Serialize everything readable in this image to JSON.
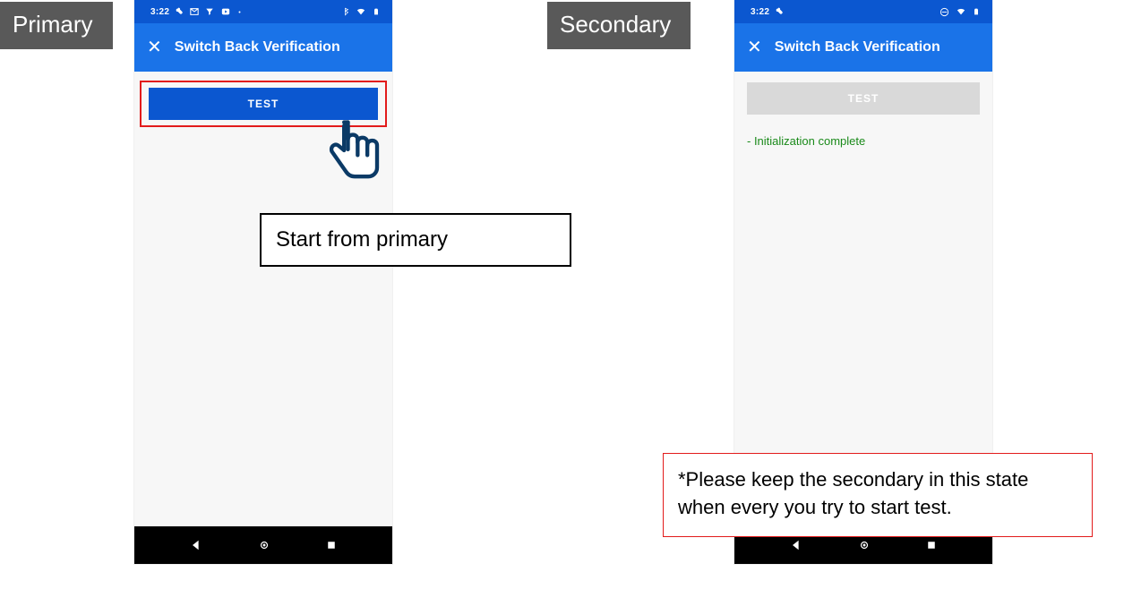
{
  "badges": {
    "primary": "Primary",
    "secondary": "Secondary"
  },
  "primary": {
    "clock": "3:22",
    "app_title": "Switch Back Verification",
    "close_glyph": "✕",
    "test_label": "TEST"
  },
  "secondary": {
    "clock": "3:22",
    "app_title": "Switch Back Verification",
    "close_glyph": "✕",
    "test_label": "TEST",
    "status_msg": "- Initialization complete"
  },
  "annotations": {
    "start_from_primary": "Start from primary",
    "keep_secondary": "*Please keep the secondary in this state when every you try to start test."
  }
}
